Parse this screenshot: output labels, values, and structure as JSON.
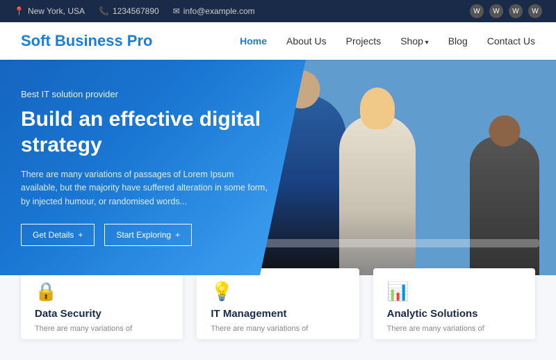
{
  "topbar": {
    "location_icon": "📍",
    "location": "New York, USA",
    "phone_icon": "📞",
    "phone": "1234567890",
    "email_icon": "✉",
    "email": "info@example.com",
    "wp_icons": [
      "W",
      "W",
      "W",
      "W"
    ]
  },
  "header": {
    "logo": "Soft Business Pro",
    "nav": [
      {
        "label": "Home",
        "active": true,
        "has_arrow": false
      },
      {
        "label": "About Us",
        "active": false,
        "has_arrow": false
      },
      {
        "label": "Projects",
        "active": false,
        "has_arrow": false
      },
      {
        "label": "Shop",
        "active": false,
        "has_arrow": true
      },
      {
        "label": "Blog",
        "active": false,
        "has_arrow": false
      },
      {
        "label": "Contact Us",
        "active": false,
        "has_arrow": false
      }
    ]
  },
  "hero": {
    "subtitle": "Best IT solution provider",
    "title": "Build an effective digital strategy",
    "description": "There are many variations of passages of Lorem Ipsum available, but the majority have suffered alteration in some form, by injected humour, or randomised words...",
    "btn1_label": "Get Details",
    "btn1_icon": "+",
    "btn2_label": "Start Exploring",
    "btn2_icon": "+"
  },
  "cards": [
    {
      "icon": "🔒",
      "title": "Data Security",
      "desc": "There are many variations of"
    },
    {
      "icon": "💡",
      "title": "IT Management",
      "desc": "There are many variations of"
    },
    {
      "icon": "📊",
      "title": "Analytic Solutions",
      "desc": "There are many variations of"
    }
  ]
}
